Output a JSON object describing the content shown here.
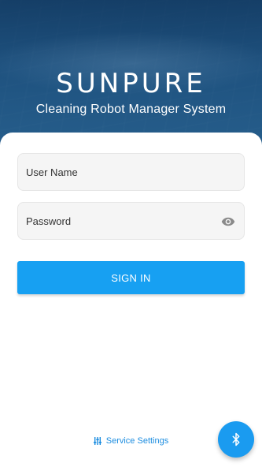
{
  "header": {
    "brand": "SUNPURE",
    "subtitle": "Cleaning Robot Manager System"
  },
  "login": {
    "username_placeholder": "User Name",
    "password_placeholder": "Password",
    "signin_label": "SIGN IN"
  },
  "footer": {
    "service_settings_label": "Service Settings"
  },
  "icons": {
    "password_toggle": "eye-icon",
    "service": "settings-sliders-icon",
    "fab": "bluetooth-icon"
  },
  "colors": {
    "accent": "#17a0f2",
    "link": "#1c8de0",
    "header_bg": "#1f5a8a"
  }
}
